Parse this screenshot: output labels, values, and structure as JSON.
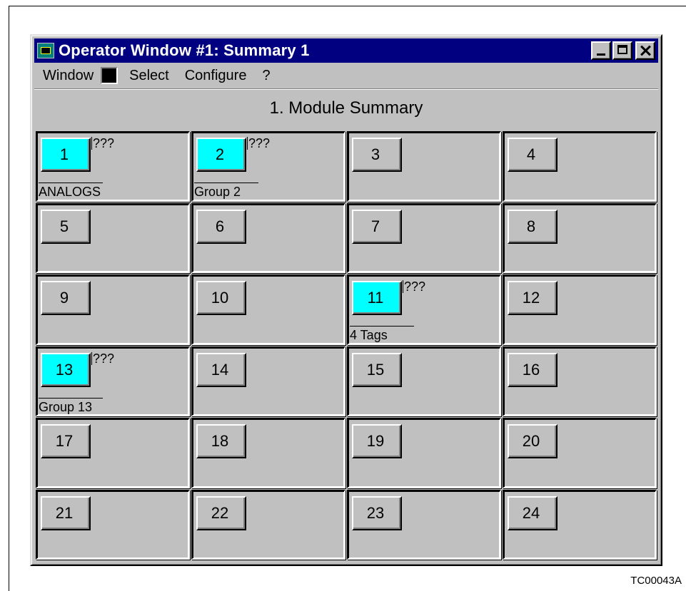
{
  "window": {
    "title": "Operator Window #1: Summary 1"
  },
  "menu": {
    "window": "Window",
    "select": "Select",
    "configure": "Configure",
    "help": "?"
  },
  "heading": "1. Module Summary",
  "modules": [
    {
      "number": "1",
      "active": true,
      "status": "???",
      "label": "ANALOGS"
    },
    {
      "number": "2",
      "active": true,
      "status": "???",
      "label": "Group 2"
    },
    {
      "number": "3",
      "active": false,
      "status": "",
      "label": ""
    },
    {
      "number": "4",
      "active": false,
      "status": "",
      "label": ""
    },
    {
      "number": "5",
      "active": false,
      "status": "",
      "label": ""
    },
    {
      "number": "6",
      "active": false,
      "status": "",
      "label": ""
    },
    {
      "number": "7",
      "active": false,
      "status": "",
      "label": ""
    },
    {
      "number": "8",
      "active": false,
      "status": "",
      "label": ""
    },
    {
      "number": "9",
      "active": false,
      "status": "",
      "label": ""
    },
    {
      "number": "10",
      "active": false,
      "status": "",
      "label": ""
    },
    {
      "number": "11",
      "active": true,
      "status": "???",
      "label": "4 Tags"
    },
    {
      "number": "12",
      "active": false,
      "status": "",
      "label": ""
    },
    {
      "number": "13",
      "active": true,
      "status": "???",
      "label": "Group 13"
    },
    {
      "number": "14",
      "active": false,
      "status": "",
      "label": ""
    },
    {
      "number": "15",
      "active": false,
      "status": "",
      "label": ""
    },
    {
      "number": "16",
      "active": false,
      "status": "",
      "label": ""
    },
    {
      "number": "17",
      "active": false,
      "status": "",
      "label": ""
    },
    {
      "number": "18",
      "active": false,
      "status": "",
      "label": ""
    },
    {
      "number": "19",
      "active": false,
      "status": "",
      "label": ""
    },
    {
      "number": "20",
      "active": false,
      "status": "",
      "label": ""
    },
    {
      "number": "21",
      "active": false,
      "status": "",
      "label": ""
    },
    {
      "number": "22",
      "active": false,
      "status": "",
      "label": ""
    },
    {
      "number": "23",
      "active": false,
      "status": "",
      "label": ""
    },
    {
      "number": "24",
      "active": false,
      "status": "",
      "label": ""
    }
  ],
  "colors": {
    "active_module": "#00ffff",
    "inactive_module": "#c0c0c0",
    "titlebar": "#000080"
  },
  "caption": "TC00043A"
}
